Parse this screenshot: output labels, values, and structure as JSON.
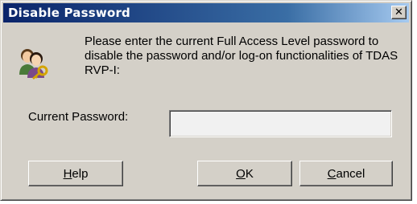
{
  "dialog": {
    "title": "Disable Password",
    "close_glyph": "✕",
    "icon": "users-key-icon",
    "message": "Please enter the current Full Access Level password to disable the password and/or log-on functionalities of TDAS RVP-I:",
    "password_label": "Current Password:",
    "password_value": "",
    "buttons": {
      "help": {
        "mnemonic": "H",
        "rest": "elp"
      },
      "ok": {
        "mnemonic": "O",
        "rest": "K"
      },
      "cancel": {
        "mnemonic": "C",
        "rest": "ancel"
      }
    }
  },
  "colors": {
    "title_bar": "#0a246a",
    "face": "#d4d0c8"
  }
}
